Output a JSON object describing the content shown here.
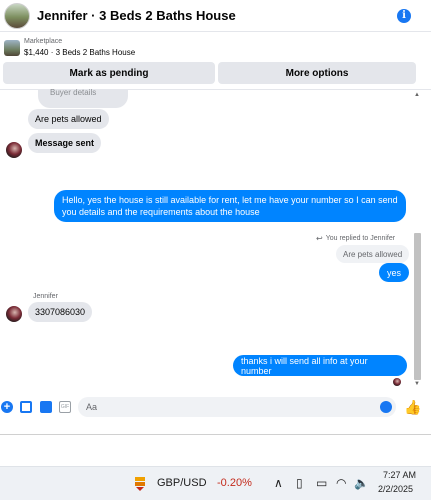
{
  "header": {
    "title": "Jennifer · 3 Beds 2 Baths House"
  },
  "listing": {
    "source": "Marketplace",
    "price_title": "$1,440 · 3 Beds 2 Baths House",
    "pending_label": "Mark as pending",
    "more_label": "More options"
  },
  "messages": {
    "partial_top": "Buyer details",
    "pets_question": "Are pets allowed",
    "message_sent": "Message sent",
    "reply_long": "Hello, yes the house is still available for rent, let me have your number so I can send you details and the requirements about the house",
    "replied_label": "You replied to Jennifer",
    "quoted": "Are pets allowed",
    "yes": "yes",
    "sender_name": "Jennifer",
    "phone": "3307086030",
    "final": "thanks i will send all info at your number"
  },
  "composer": {
    "placeholder": "Aa"
  },
  "taskbar": {
    "ticker_symbol": "GBP/USD",
    "ticker_change": "-0.20%",
    "time": "7:27 AM",
    "date": "2/2/2025"
  },
  "colors": {
    "accent": "#0084ff",
    "brand": "#1877f2",
    "negative": "#c42b1c"
  }
}
